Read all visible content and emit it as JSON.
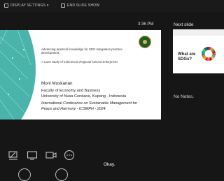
{
  "toolbar": {
    "display_settings": "DISPLAY SETTINGS ▾",
    "end_slide_show": "END SLIDE SHOW"
  },
  "presenter": {
    "time": "3:36 PM",
    "next_slide_label": "Next slide",
    "notes": "No Notes.",
    "toast": "Okay."
  },
  "slide": {
    "title": "Advancing practical knowledge for SDG integration practice development:",
    "subtitle": "A Case Study of Indonesian Regional-Owned Enterprises",
    "author": "Moni Muskanan",
    "affiliation_1": "Faculty of Economy and Business",
    "affiliation_2": "University of Nusa Cendana, Kupang - Indonesia",
    "conference": "International Conference on Sustainable Management for Peace and Harmony - ICSMPH - 2024"
  },
  "next_slide": {
    "title": "What are SDGs?"
  },
  "colors": {
    "background": "#161616",
    "teal_decoration": "#2aa79b",
    "sdg_palette": [
      "#e5243b",
      "#dda63a",
      "#4c9f38",
      "#c5192d",
      "#ff3a21",
      "#26bde2",
      "#fcc30b",
      "#a21942",
      "#fd6925",
      "#dd1367",
      "#fd9d24",
      "#bf8b2e",
      "#3f7e44",
      "#0a97d9",
      "#56c02b",
      "#00689d",
      "#19486a"
    ]
  },
  "icons": {
    "display_settings": "display-icon",
    "end_slide_show": "end-show-icon",
    "pen": "pen-icon",
    "screen": "screen-icon",
    "camera": "camera-icon",
    "more": "more-icon"
  }
}
